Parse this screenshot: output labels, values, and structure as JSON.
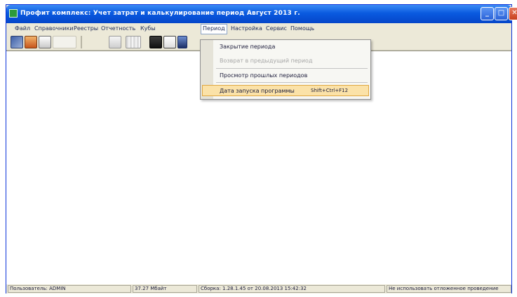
{
  "window": {
    "title": "Профит комплекс: Учет затрат и калькулирование период Август 2013 г."
  },
  "menu": {
    "items": [
      "Файл",
      "Справочники",
      "Реестры",
      "Отчетность",
      "Кубы",
      "Период",
      "Настройка",
      "Сервис",
      "Помощь"
    ],
    "active": "Период"
  },
  "toolbar": {
    "icons": [
      "book-icon",
      "person-icon",
      "document-icon",
      "blank-icon",
      "search-icon",
      "grid-icon",
      "calculator-icon",
      "page-icon",
      "refresh-icon"
    ]
  },
  "dropdown": {
    "items": [
      {
        "label": "Закрытие периода",
        "enabled": true
      },
      {
        "label": "Возврат в предыдущий период",
        "enabled": false
      },
      {
        "label": "Просмотр прошлых периодов",
        "enabled": true
      },
      {
        "label": "Дата запуска программы",
        "shortcut": "Shift+Ctrl+F12",
        "enabled": true,
        "highlighted": true
      }
    ]
  },
  "statusbar": {
    "user": "Пользователь: ADMIN",
    "memory": "37.27 Мбайт",
    "version": "Сборка: 1.28.1.45 от 20.08.2013 15:42:32",
    "mode": "Не использовать отложенное проведение"
  },
  "colors": {
    "titlebar": "#0a5ae0",
    "highlight": "#fbe2a8",
    "close": "#c8401e"
  }
}
